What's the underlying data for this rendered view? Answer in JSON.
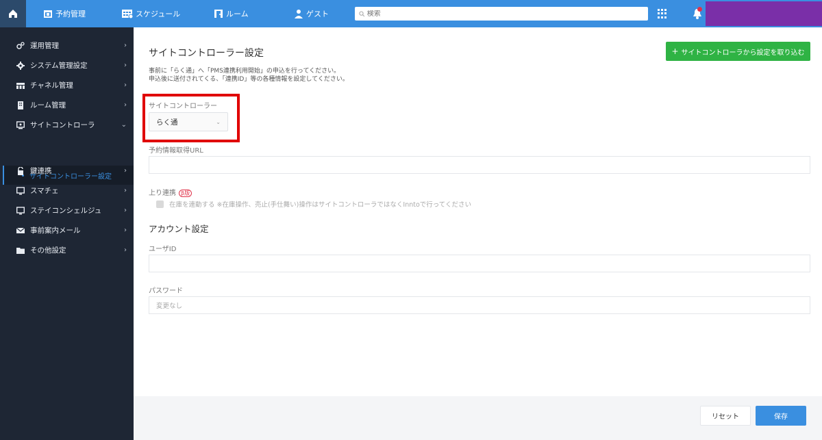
{
  "topbar": {
    "nav": [
      "予約管理",
      "スケジュール",
      "ルーム",
      "ゲスト"
    ],
    "search_placeholder": "検索"
  },
  "sidebar": {
    "items": [
      {
        "label": "運用管理",
        "icon": "gears-icon",
        "chevron": "›"
      },
      {
        "label": "システム管理設定",
        "icon": "gear-icon",
        "chevron": "›"
      },
      {
        "label": "チャネル管理",
        "icon": "channel-icon",
        "chevron": "›"
      },
      {
        "label": "ルーム管理",
        "icon": "building-icon",
        "chevron": "›"
      },
      {
        "label": "サイトコントローラ",
        "icon": "monitor-icon",
        "chevron": "⌄"
      },
      {
        "label": "鍵連携",
        "icon": "lock-icon",
        "chevron": "›"
      },
      {
        "label": "スマチェ",
        "icon": "screen-icon",
        "chevron": "›"
      },
      {
        "label": "ステイコンシェルジュ",
        "icon": "screen-icon",
        "chevron": "›"
      },
      {
        "label": "事前案内メール",
        "icon": "mail-icon",
        "chevron": "›"
      },
      {
        "label": "その他設定",
        "icon": "folder-icon",
        "chevron": "›"
      }
    ],
    "sub_item": "サイトコントローラー設定"
  },
  "main": {
    "title": "サイトコントローラー設定",
    "import_button": "サイトコントローラから設定を取り込む",
    "import_plus": "+",
    "desc1": "事前に「らく通」へ「PMS連携利用開始」の申込を行ってください。",
    "desc2": "申込後に送付されてくる、「連携ID」等の各種情報を設定してください。",
    "site_controller_label": "サイトコントローラー",
    "site_controller_value": "らく通",
    "reservation_url_label": "予約情報取得URL",
    "reservation_url_value": "",
    "uplink_label": "上り連携",
    "uplink_badge": "β版",
    "uplink_checkbox_text": "在庫を連動する ※在庫操作、売止(手仕舞い)操作はサイトコントローラではなくInntoで行ってください",
    "account_section": "アカウント設定",
    "user_id_label": "ユーザID",
    "user_id_value": "",
    "password_label": "パスワード",
    "password_placeholder": "変更なし"
  },
  "footer": {
    "reset": "リセット",
    "save": "保存"
  },
  "colors": {
    "topbar": "#3a8fe0",
    "sidebar": "#1e2634",
    "import_button": "#2fb344",
    "save_button": "#3a8fe0",
    "highlight": "#e00000"
  }
}
